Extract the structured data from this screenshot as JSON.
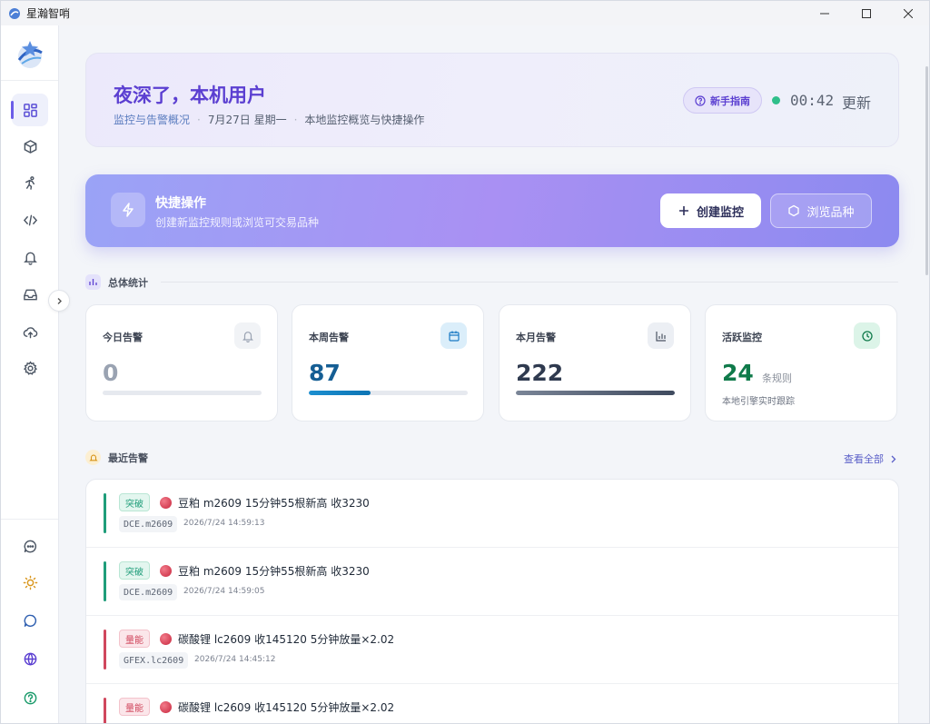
{
  "window": {
    "title": "星瀚智哨"
  },
  "sidebar": {
    "nav": [
      "dashboard",
      "box",
      "activity",
      "code",
      "bell",
      "inbox",
      "upload",
      "settings"
    ],
    "bottom": [
      "feedback",
      "theme",
      "chat",
      "language",
      "help"
    ]
  },
  "hero": {
    "greeting": "夜深了，本机用户",
    "subtitle_1": "监控与告警概况",
    "dot": "·",
    "date": "7月27日 星期一",
    "subtitle_3": "本地监控概览与快捷操作",
    "guide_label": "新手指南",
    "update_time": "00:42",
    "update_label": "更新"
  },
  "quick": {
    "title": "快捷操作",
    "subtitle": "创建新监控规则或浏览可交易品种",
    "create_label": "创建监控",
    "browse_label": "浏览品种"
  },
  "stats": {
    "section_title": "总体统计",
    "cards": [
      {
        "label": "今日告警",
        "value": "0",
        "color": "#9aa3b2",
        "fill": 0
      },
      {
        "label": "本周告警",
        "value": "87",
        "color": "#155e94",
        "fill": 0.39
      },
      {
        "label": "本月告警",
        "value": "222",
        "color": "#2f3a4f",
        "fill": 1.0
      },
      {
        "label": "活跃监控",
        "value": "24",
        "unit": "条规则",
        "note": "本地引擎实时跟踪",
        "color": "#0f7a4a"
      }
    ]
  },
  "alerts": {
    "section_title": "最近告警",
    "view_all": "查看全部",
    "items": [
      {
        "tag": "突破",
        "title": "豆粕 m2609 15分钟55根新高 收3230",
        "code": "DCE.m2609",
        "time": "2026/7/24 14:59:13",
        "kind": "break"
      },
      {
        "tag": "突破",
        "title": "豆粕 m2609 15分钟55根新高 收3230",
        "code": "DCE.m2609",
        "time": "2026/7/24 14:59:05",
        "kind": "break"
      },
      {
        "tag": "量能",
        "title": "碳酸锂 lc2609 收145120 5分钟放量×2.02",
        "code": "GFEX.lc2609",
        "time": "2026/7/24 14:45:12",
        "kind": "volume"
      },
      {
        "tag": "量能",
        "title": "碳酸锂 lc2609 收145120 5分钟放量×2.02",
        "code": "",
        "time": "",
        "kind": "volume"
      }
    ]
  },
  "colors": {
    "accent": "#6b5de8",
    "break": "#1f9d7a",
    "volume": "#d0475d"
  }
}
